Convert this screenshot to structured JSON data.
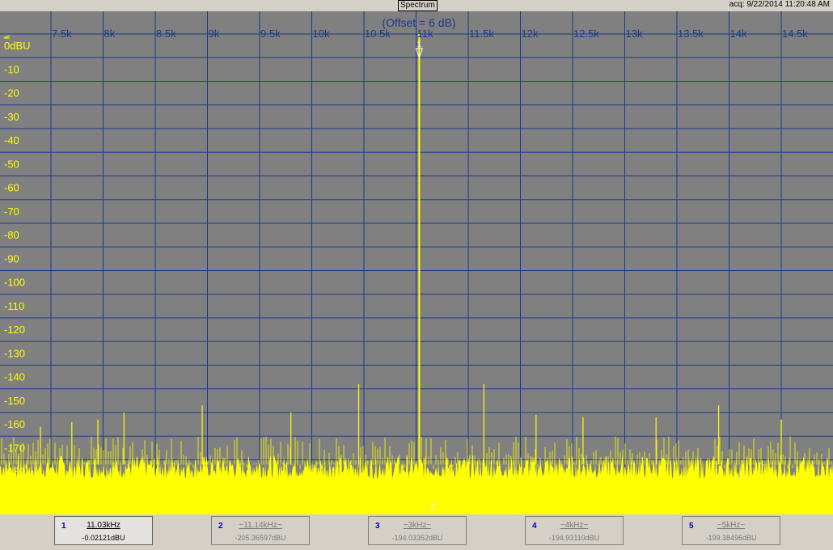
{
  "window": {
    "title": "Spectrum",
    "acq": "acq: 9/22/2014 11:20:48 AM"
  },
  "colors": {
    "background": "#808080",
    "grid": "#1a3a8c",
    "trace": "#ffff00",
    "freq_labels": "#1a3a8c",
    "level_labels": "#ffff00"
  },
  "chart_data": {
    "type": "line",
    "title": "",
    "annotation": "(Offset = 6 dB)",
    "x_tick_labels": [
      "7.5k",
      "8k",
      "8.5k",
      "9k",
      "9.5k",
      "10k",
      "10.5k",
      "11k",
      "11.5k",
      "12k",
      "12.5k",
      "13k",
      "13.5k",
      "14k",
      "14.5k"
    ],
    "y_tick_labels": [
      "0dBU",
      "-10",
      "-20",
      "-30",
      "-40",
      "-50",
      "-60",
      "-70",
      "-80",
      "-90",
      "-100",
      "-110",
      "-120",
      "-130",
      "-140",
      "-150",
      "-160",
      "-170",
      "-180"
    ],
    "xlim": [
      7250,
      15000
    ],
    "ylim": [
      -196,
      6
    ],
    "grid": true,
    "noise_floor": [
      -188,
      -178
    ],
    "spurs": [
      {
        "x": 7400,
        "y": -166
      },
      {
        "x": 7700,
        "y": -164
      },
      {
        "x": 7950,
        "y": -163
      },
      {
        "x": 8200,
        "y": -160
      },
      {
        "x": 8950,
        "y": -157
      },
      {
        "x": 9800,
        "y": -160
      },
      {
        "x": 10450,
        "y": -148
      },
      {
        "x": 11650,
        "y": -148
      },
      {
        "x": 12150,
        "y": -161
      },
      {
        "x": 12600,
        "y": -162
      },
      {
        "x": 13300,
        "y": -162
      },
      {
        "x": 13900,
        "y": -157
      },
      {
        "x": 14500,
        "y": -163
      }
    ],
    "peak": {
      "x": 11030,
      "y": -0.02121,
      "label": "1"
    },
    "marker_2_label": "2",
    "markers": [
      {
        "num": "1",
        "freq": "11.03kHz",
        "level": "-0.02121dBU"
      },
      {
        "num": "2",
        "freq": "~11.14kHz~",
        "level": "-205.36597dBU"
      },
      {
        "num": "3",
        "freq": "~3kHz~",
        "level": "-194.03352dBU"
      },
      {
        "num": "4",
        "freq": "~4kHz~",
        "level": "-194.93110dBU"
      },
      {
        "num": "5",
        "freq": "~5kHz~",
        "level": "-199.38496dBU"
      }
    ]
  }
}
